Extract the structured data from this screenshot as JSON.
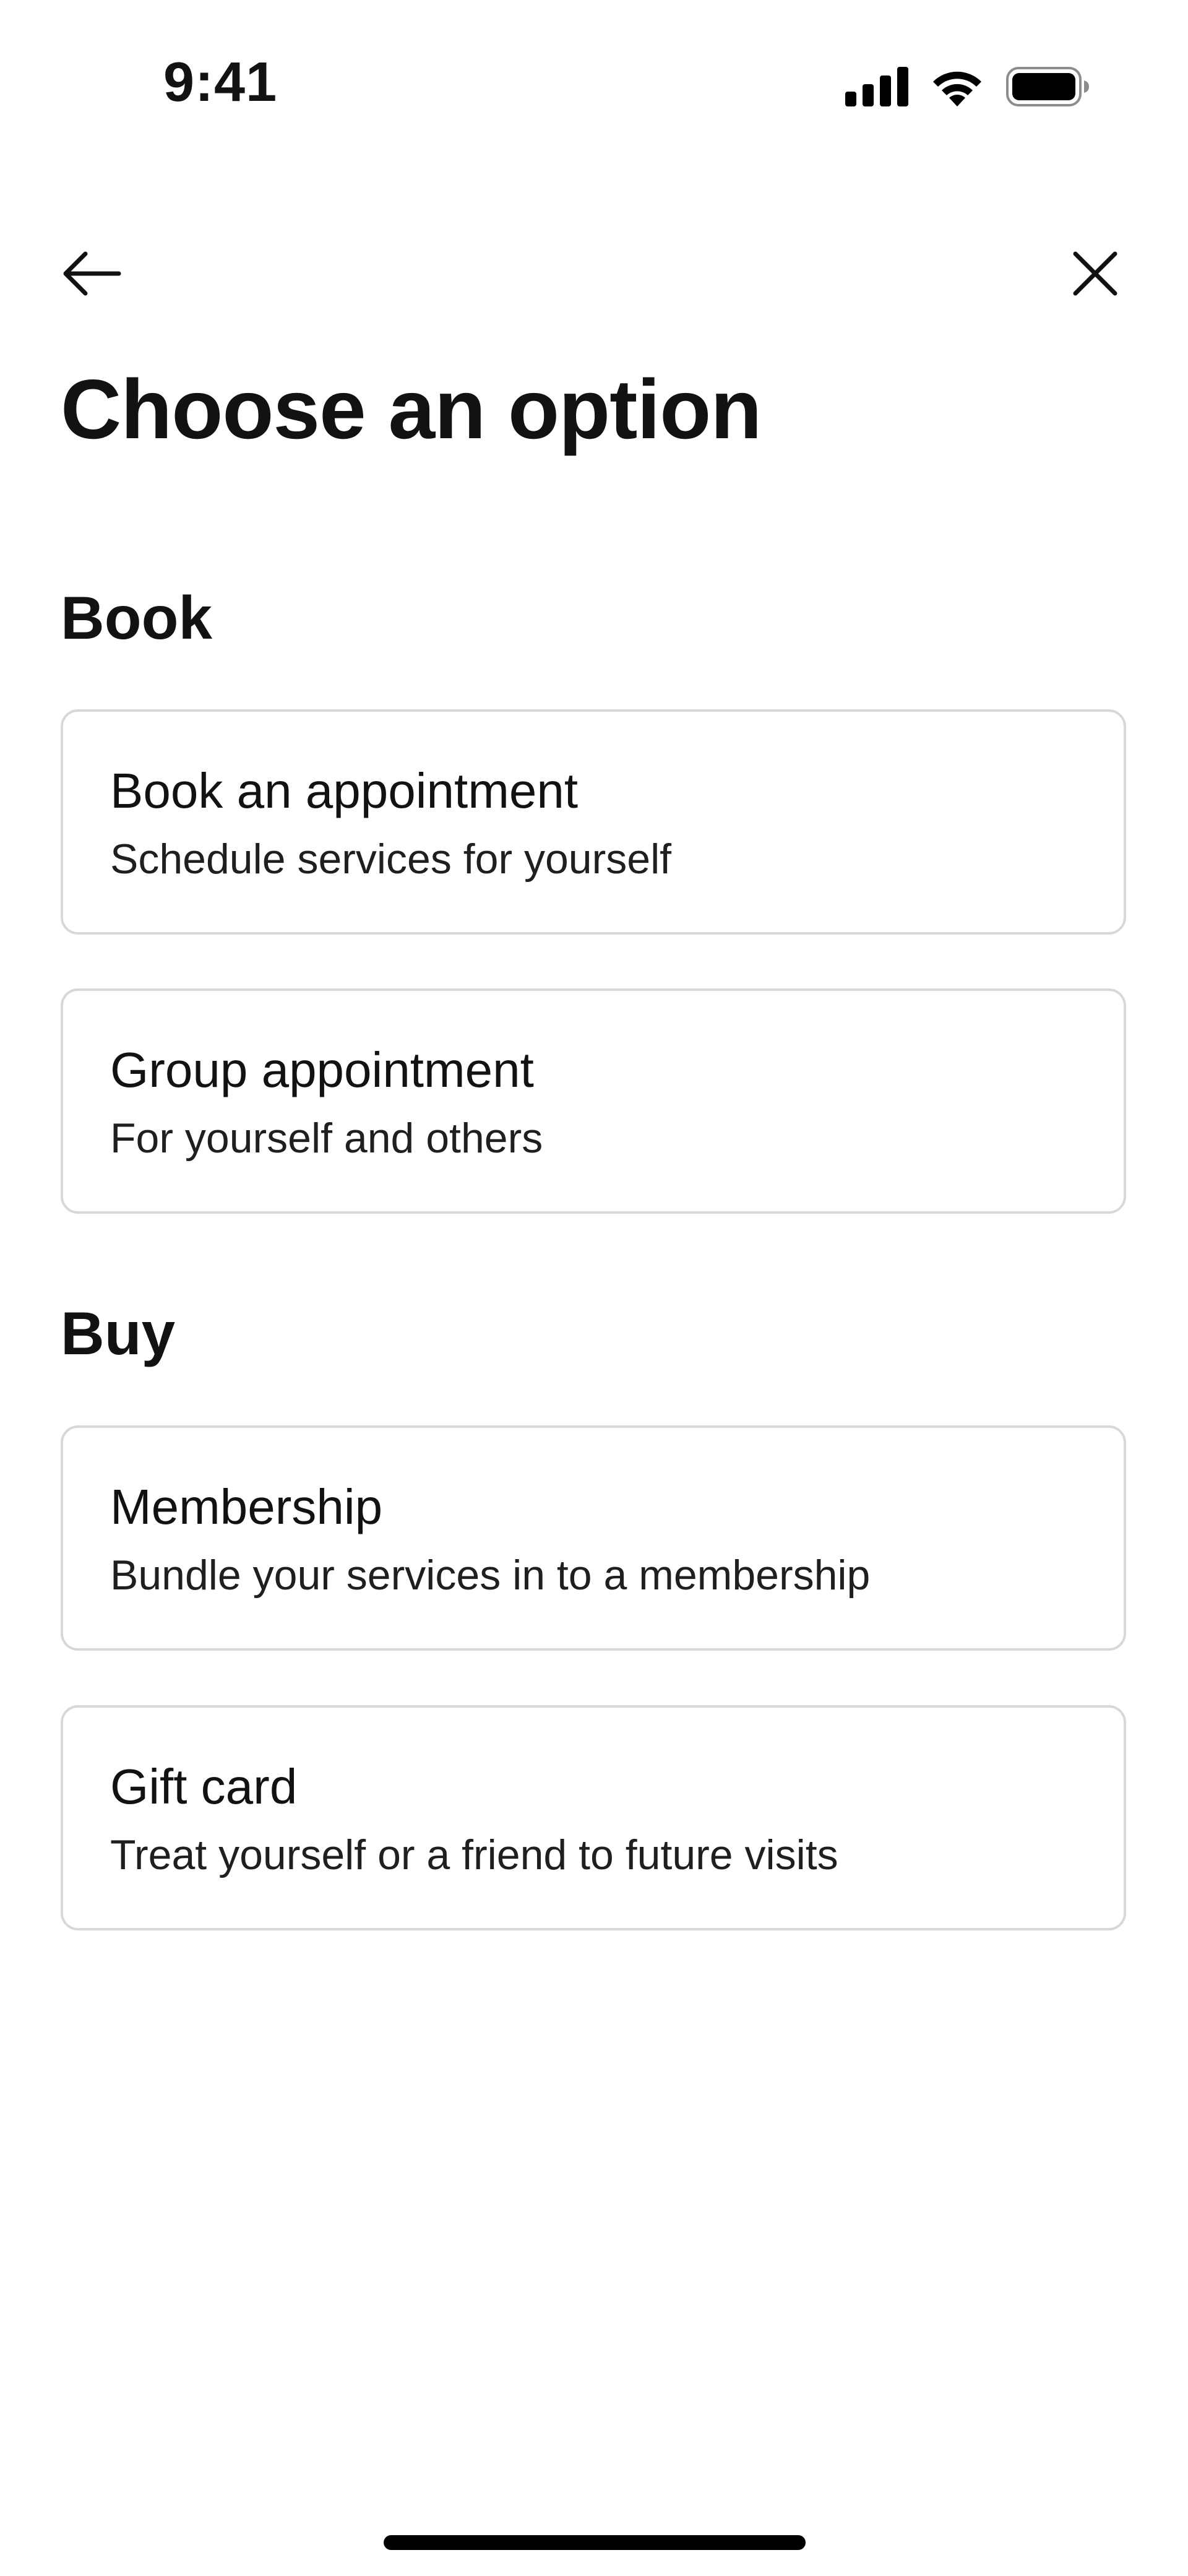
{
  "status_bar": {
    "time": "9:41",
    "icons": [
      "cellular-signal-icon",
      "wifi-icon",
      "battery-icon"
    ]
  },
  "nav": {
    "back_icon": "arrow-left-icon",
    "close_icon": "close-icon"
  },
  "page": {
    "title": "Choose an option"
  },
  "sections": {
    "book": {
      "heading": "Book",
      "options": [
        {
          "title": "Book an appointment",
          "subtitle": "Schedule services for yourself"
        },
        {
          "title": "Group appointment",
          "subtitle": "For yourself and others"
        }
      ]
    },
    "buy": {
      "heading": "Buy",
      "options": [
        {
          "title": "Membership",
          "subtitle": "Bundle your services in to a membership"
        },
        {
          "title": "Gift card",
          "subtitle": "Treat yourself or a friend to future visits"
        }
      ]
    }
  },
  "colors": {
    "text": "#121212",
    "card_border": "#d8d8d8",
    "background": "#ffffff"
  }
}
